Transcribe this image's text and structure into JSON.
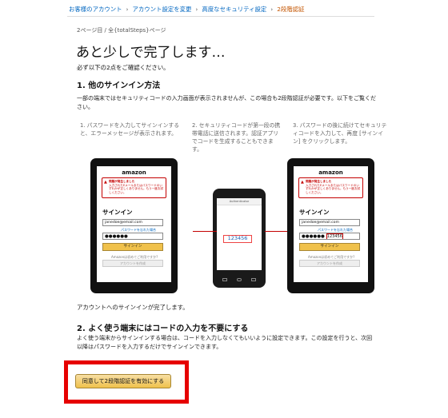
{
  "breadcrumb": {
    "items": [
      "お客様のアカウント",
      "アカウント設定を変更",
      "高度なセキュリティ設定"
    ],
    "current": "2段階認証"
  },
  "step_text": "2ページ目 / 全{totalSteps}ページ",
  "title": "あと少しで完了します…",
  "intro": "必ず以下の2点をご確認ください。",
  "section1": {
    "heading": "1. 他のサインイン方法",
    "body": "一部の端末ではセキュリティコードの入力画面が表示されませんが、この場合も2段階認証が必要です。以下をご覧ください。",
    "steps": [
      "1. パスワードを入力してサインインすると、エラーメッセージが表示されます。",
      "2. セキュリティコードが第一段の携帯電話に送信されます。認証アプリでコードを生成することもできます。",
      "3. パスワードの後に続けてセキュリティコードを入力して、再度 [サインイン] をクリックします。"
    ],
    "done": "アカウントへのサインインが完了します。"
  },
  "device": {
    "brand": "amazon",
    "alert_title": "問題が発生しました",
    "alert_text": "入力されたEメールまたはパスワードのいずれかが正しくありません。もう一度お試しください。",
    "signin_heading": "サインイン",
    "email": "janedoe@email.com",
    "password_dots": "●●●●●●",
    "forgot": "パスワードを忘れた場合",
    "signin_btn": "サインイン",
    "new_customer": "Amazonは初めてご利用ですか?",
    "create_btn": "アカウントを作成",
    "phone_app": "Authenticator",
    "code": "123456"
  },
  "section2": {
    "heading": "2. よく使う端末にはコードの入力を不要にする",
    "body": "よく使う端末からサインインする場合は、コードを入力しなくてもいいように設定できます。この設定を行うと、次回以降はパスワードを入力するだけでサインインできます。"
  },
  "confirm_button": "同意して2段階認証を有効にする"
}
